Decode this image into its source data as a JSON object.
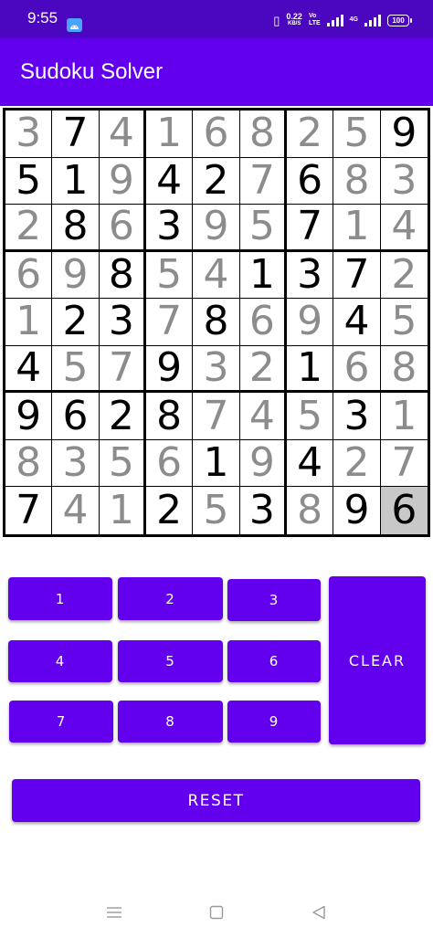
{
  "status_bar": {
    "time": "9:55",
    "net_speed": "0.22",
    "net_unit": "KB/S",
    "volte_top": "Vo",
    "volte_bottom": "LTE",
    "network": "4G",
    "battery": "100"
  },
  "app_bar": {
    "title": "Sudoku Solver"
  },
  "board": {
    "rows": [
      [
        "3",
        "7",
        "4",
        "1",
        "6",
        "8",
        "2",
        "5",
        "9"
      ],
      [
        "5",
        "1",
        "9",
        "4",
        "2",
        "7",
        "6",
        "8",
        "3"
      ],
      [
        "2",
        "8",
        "6",
        "3",
        "9",
        "5",
        "7",
        "1",
        "4"
      ],
      [
        "6",
        "9",
        "8",
        "5",
        "4",
        "1",
        "3",
        "7",
        "2"
      ],
      [
        "1",
        "2",
        "3",
        "7",
        "8",
        "6",
        "9",
        "4",
        "5"
      ],
      [
        "4",
        "5",
        "7",
        "9",
        "3",
        "2",
        "1",
        "6",
        "8"
      ],
      [
        "9",
        "6",
        "2",
        "8",
        "7",
        "4",
        "5",
        "3",
        "1"
      ],
      [
        "8",
        "3",
        "5",
        "6",
        "1",
        "9",
        "4",
        "2",
        "7"
      ],
      [
        "7",
        "4",
        "1",
        "2",
        "5",
        "3",
        "8",
        "9",
        "6"
      ]
    ],
    "given": [
      [
        0,
        1,
        0,
        0,
        0,
        0,
        0,
        0,
        1
      ],
      [
        1,
        1,
        0,
        1,
        1,
        0,
        1,
        0,
        0
      ],
      [
        0,
        1,
        0,
        1,
        0,
        0,
        1,
        0,
        0
      ],
      [
        0,
        0,
        1,
        0,
        0,
        1,
        1,
        1,
        0
      ],
      [
        0,
        1,
        1,
        0,
        1,
        0,
        0,
        1,
        0
      ],
      [
        1,
        0,
        0,
        1,
        0,
        0,
        1,
        0,
        0
      ],
      [
        1,
        1,
        1,
        1,
        0,
        0,
        0,
        1,
        0
      ],
      [
        0,
        0,
        0,
        0,
        1,
        0,
        1,
        0,
        0
      ],
      [
        1,
        0,
        0,
        1,
        0,
        1,
        0,
        1,
        0
      ]
    ],
    "selected": [
      8,
      8
    ],
    "given_color": "#000000",
    "solved_color": "#8c8c8c",
    "selected_bg": "#c8c8c8"
  },
  "keypad": {
    "digits": [
      "1",
      "2",
      "3",
      "4",
      "5",
      "6",
      "7",
      "8",
      "9"
    ],
    "clear_label": "CLEAR",
    "reset_label": "RESET",
    "accent": "#6200ee"
  },
  "nav_bar": {
    "icons": [
      "menu-icon",
      "home-icon",
      "back-icon"
    ]
  }
}
